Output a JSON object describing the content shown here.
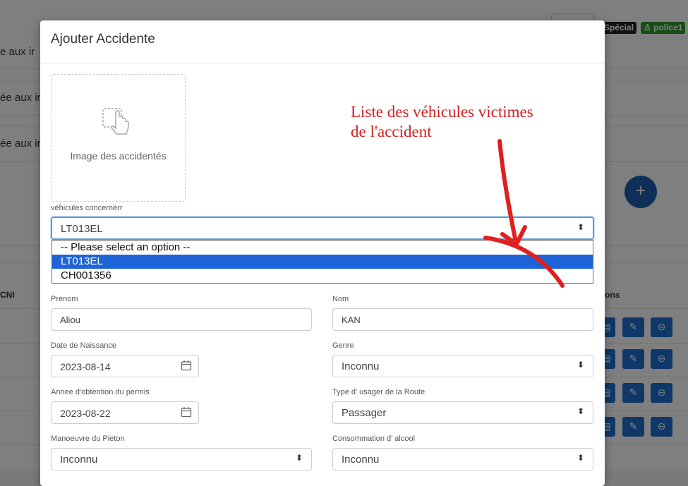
{
  "background": {
    "row_text": [
      "ée aux ir",
      "ée aux ir",
      "e aux ir"
    ],
    "badges": [
      "Spécial",
      "police1"
    ],
    "col_cni": "CNI",
    "col_actions": "ons",
    "fab_label": "+",
    "action_icons": [
      "print-icon",
      "edit-icon",
      "remove-icon"
    ]
  },
  "modal": {
    "title": "Ajouter Accidente",
    "image_upload": {
      "label": "Image des accidentés",
      "icon": "hand-pointer-icon"
    },
    "vehicles": {
      "label": "véhicules concernérr",
      "value": "LT013EL",
      "options": [
        "-- Please select an option --",
        "LT013EL",
        "CH001356"
      ],
      "selected_index": 1
    },
    "fields": {
      "prenom": {
        "label": "Prenom",
        "value": "Aliou"
      },
      "nom": {
        "label": "Nom",
        "value": "KAN"
      },
      "date_naissance": {
        "label": "Date de Naissance",
        "value": "2023-08-14"
      },
      "genre": {
        "label": "Genre",
        "value": "Inconnu"
      },
      "annee_permis": {
        "label": "Annee d'obtention du permis",
        "value": "2023-08-22"
      },
      "type_usager": {
        "label": "Type d' usager de la Route",
        "value": "Passager"
      },
      "manoeuvre": {
        "label": "Manoeuvre du Pieton",
        "value": "Inconnu"
      },
      "alcool": {
        "label": "Consommation d' alcool",
        "value": "Inconnu"
      }
    }
  },
  "annotation": {
    "line1": "Liste des véhicules victimes",
    "line2": "de l'accident",
    "color": "#e02020"
  }
}
